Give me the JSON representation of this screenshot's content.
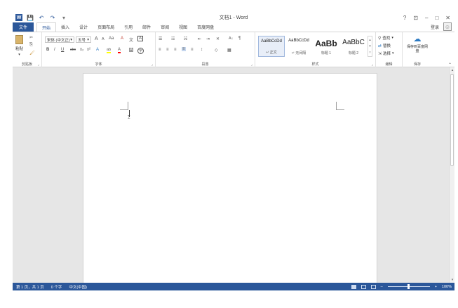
{
  "window": {
    "title": "文档1 - Word",
    "help": "?",
    "ribbon_display": "⊡",
    "minimize": "–",
    "restore": "□",
    "close": "✕"
  },
  "qat": {
    "save": "💾",
    "undo": "↶",
    "redo": "↷",
    "customize": "▾"
  },
  "tabs": [
    {
      "label": "文件"
    },
    {
      "label": "开始"
    },
    {
      "label": "插入"
    },
    {
      "label": "设计"
    },
    {
      "label": "页面布局"
    },
    {
      "label": "引用"
    },
    {
      "label": "邮件"
    },
    {
      "label": "审阅"
    },
    {
      "label": "视图"
    },
    {
      "label": "百度网盘"
    }
  ],
  "account": {
    "login": "登录"
  },
  "ribbon": {
    "clipboard": {
      "label": "剪贴板",
      "paste": "粘贴",
      "cut": "✂",
      "copy": "⎘",
      "format_painter": "🖌"
    },
    "font": {
      "label": "字体",
      "font_name": "宋体 (中文正)",
      "font_size": "五号",
      "grow": "A",
      "shrink": "A",
      "case": "Aa",
      "clear": "A",
      "phonetic": "文",
      "border_char": "A",
      "bold": "B",
      "italic": "I",
      "underline": "U",
      "strike": "abc",
      "subscript": "x₂",
      "superscript": "x²",
      "effects": "A",
      "highlight": "ab",
      "font_color": "A",
      "shading": "A",
      "enclose": "字"
    },
    "paragraph": {
      "label": "段落",
      "bullets": "☰",
      "numbering": "☷",
      "multilevel": "☵",
      "decrease_indent": "⇤",
      "increase_indent": "⇥",
      "chinese_layout": "✕",
      "sort": "A↓",
      "show_marks": "¶",
      "align_left": "≡",
      "align_center": "≡",
      "align_right": "≡",
      "justify": "≡",
      "distributed": "≡",
      "line_spacing": "↕",
      "shading": "◇",
      "borders": "▦"
    },
    "styles": {
      "label": "样式",
      "items": [
        {
          "sample": "AaBbCcDd",
          "name": "↵ 正文"
        },
        {
          "sample": "AaBbCcDd",
          "name": "↵ 无间隔"
        },
        {
          "sample": "AaBb",
          "name": "标题 1"
        },
        {
          "sample": "AaBbC",
          "name": "标题 2"
        }
      ]
    },
    "editing": {
      "label": "编辑",
      "find": "查找",
      "replace": "替换",
      "select": "选择"
    },
    "save": {
      "label": "保存",
      "button": "保存到百度网盘"
    }
  },
  "statusbar": {
    "page": "第 1 页，共 1 页",
    "words": "0 个字",
    "language": "中文(中国)",
    "zoom": "100%",
    "zoom_minus": "–",
    "zoom_plus": "+"
  },
  "colors": {
    "accent": "#2b579a",
    "highlight": "#ffff00",
    "font_color": "#ff0000"
  }
}
